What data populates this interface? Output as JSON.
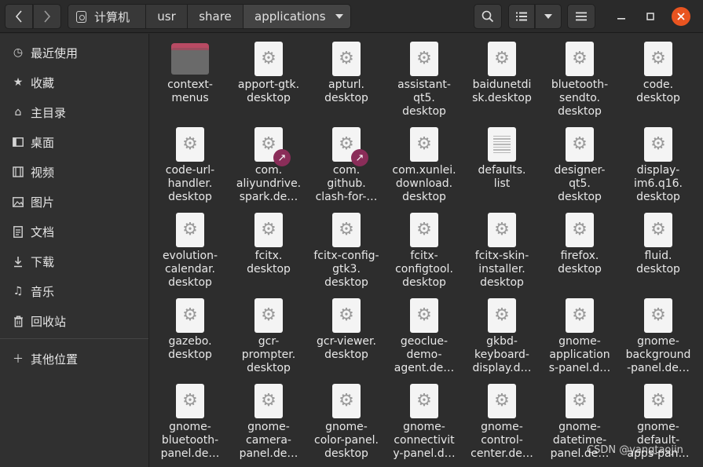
{
  "header": {
    "path": [
      "计算机",
      "usr",
      "share",
      "applications"
    ]
  },
  "sidebar": {
    "items": [
      {
        "label": "最近使用",
        "icon": "clock-icon"
      },
      {
        "label": "收藏",
        "icon": "star-icon"
      },
      {
        "label": "主目录",
        "icon": "home-icon"
      },
      {
        "label": "桌面",
        "icon": "desktop-icon"
      },
      {
        "label": "视频",
        "icon": "video-icon"
      },
      {
        "label": "图片",
        "icon": "image-icon"
      },
      {
        "label": "文档",
        "icon": "document-icon"
      },
      {
        "label": "下载",
        "icon": "download-icon"
      },
      {
        "label": "音乐",
        "icon": "music-icon"
      },
      {
        "label": "回收站",
        "icon": "trash-icon"
      },
      {
        "label": "其他位置",
        "icon": "plus-icon"
      }
    ]
  },
  "files": [
    {
      "name": "context-\nmenus",
      "type": "folder"
    },
    {
      "name": "apport-gtk.\ndesktop",
      "type": "desktop"
    },
    {
      "name": "apturl.\ndesktop",
      "type": "desktop"
    },
    {
      "name": "assistant-\nqt5.\ndesktop",
      "type": "desktop"
    },
    {
      "name": "baidunetdi\nsk.desktop",
      "type": "desktop"
    },
    {
      "name": "bluetooth-\nsendto.\ndesktop",
      "type": "desktop"
    },
    {
      "name": "code.\ndesktop",
      "type": "desktop"
    },
    {
      "name": "code-url-\nhandler.\ndesktop",
      "type": "desktop"
    },
    {
      "name": "com.\naliyundrive.\nspark.de…",
      "type": "link"
    },
    {
      "name": "com.\ngithub.\nclash-for-…",
      "type": "link"
    },
    {
      "name": "com.xunlei.\ndownload.\ndesktop",
      "type": "desktop"
    },
    {
      "name": "defaults.\nlist",
      "type": "text"
    },
    {
      "name": "designer-\nqt5.\ndesktop",
      "type": "desktop"
    },
    {
      "name": "display-\nim6.q16.\ndesktop",
      "type": "desktop"
    },
    {
      "name": "evolution-\ncalendar.\ndesktop",
      "type": "desktop"
    },
    {
      "name": "fcitx.\ndesktop",
      "type": "desktop"
    },
    {
      "name": "fcitx-config-\ngtk3.\ndesktop",
      "type": "desktop"
    },
    {
      "name": "fcitx-\nconfigtool.\ndesktop",
      "type": "desktop"
    },
    {
      "name": "fcitx-skin-\ninstaller.\ndesktop",
      "type": "desktop"
    },
    {
      "name": "firefox.\ndesktop",
      "type": "desktop"
    },
    {
      "name": "fluid.\ndesktop",
      "type": "desktop"
    },
    {
      "name": "gazebo.\ndesktop",
      "type": "desktop"
    },
    {
      "name": "gcr-\nprompter.\ndesktop",
      "type": "desktop"
    },
    {
      "name": "gcr-viewer.\ndesktop",
      "type": "desktop"
    },
    {
      "name": "geoclue-\ndemo-\nagent.de…",
      "type": "desktop"
    },
    {
      "name": "gkbd-\nkeyboard-\ndisplay.d…",
      "type": "desktop"
    },
    {
      "name": "gnome-\napplication\ns-panel.d…",
      "type": "desktop"
    },
    {
      "name": "gnome-\nbackground\n-panel.de…",
      "type": "desktop"
    },
    {
      "name": "gnome-\nbluetooth-\npanel.de…",
      "type": "desktop"
    },
    {
      "name": "gnome-\ncamera-\npanel.de…",
      "type": "desktop"
    },
    {
      "name": "gnome-\ncolor-panel.\ndesktop",
      "type": "desktop"
    },
    {
      "name": "gnome-\nconnectivit\ny-panel.d…",
      "type": "desktop"
    },
    {
      "name": "gnome-\ncontrol-\ncenter.de…",
      "type": "desktop"
    },
    {
      "name": "gnome-\ndatetime-\npanel.de…",
      "type": "desktop"
    },
    {
      "name": "gnome-\ndefault-\napps-pan…",
      "type": "desktop"
    }
  ],
  "watermark": "CSDN @yangtaojin"
}
